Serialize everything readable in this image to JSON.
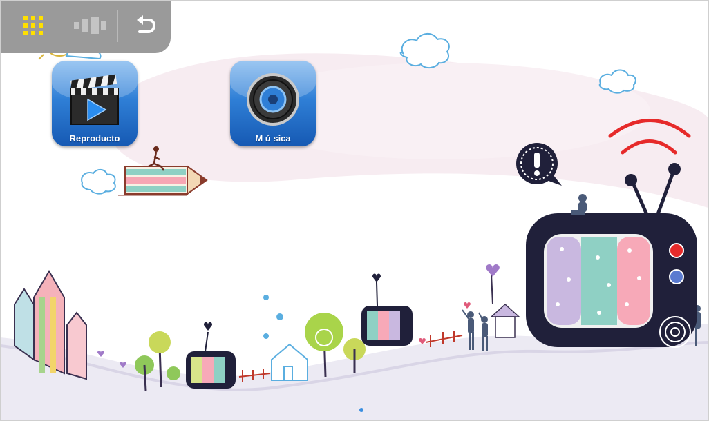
{
  "toolbar": {
    "apps_grid_icon": "grid-icon",
    "widgets_icon": "widgets-icon",
    "back_icon": "back-icon"
  },
  "apps": [
    {
      "label": "Reproducto",
      "icon": "clapperboard-icon"
    },
    {
      "label": "M ú sica",
      "icon": "speaker-icon"
    }
  ],
  "colors": {
    "toolbar_bg": "#9a9a9a",
    "grid_icon": "#ffe000",
    "app_tile_blue": "#1f6cc8",
    "tv_body": "#20203a",
    "signal_red": "#e62a2a",
    "page_dot": "#3b8fe0"
  }
}
